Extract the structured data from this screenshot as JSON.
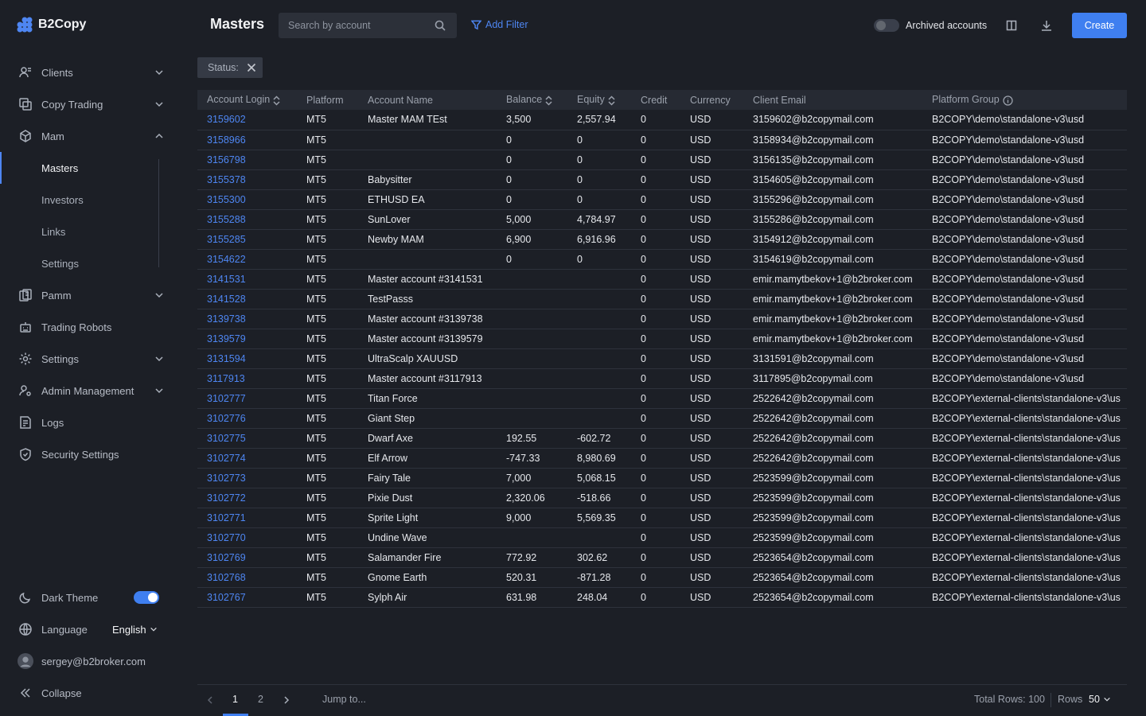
{
  "app": {
    "name": "B2Copy"
  },
  "sidebar": {
    "items": [
      {
        "label": "Clients",
        "icon": "clients-icon",
        "expandable": true
      },
      {
        "label": "Copy Trading",
        "icon": "copy-trading-icon",
        "expandable": true
      },
      {
        "label": "Mam",
        "icon": "mam-icon",
        "expanded": true
      },
      {
        "label": "Pamm",
        "icon": "pamm-icon",
        "expandable": true
      },
      {
        "label": "Trading Robots",
        "icon": "robot-icon"
      },
      {
        "label": "Settings",
        "icon": "gear-icon",
        "expandable": true
      },
      {
        "label": "Admin Management",
        "icon": "admin-icon",
        "expandable": true
      },
      {
        "label": "Logs",
        "icon": "logs-icon"
      },
      {
        "label": "Security Settings",
        "icon": "shield-icon"
      }
    ],
    "mam_sub": [
      "Masters",
      "Investors",
      "Links",
      "Settings"
    ],
    "dark_theme_label": "Dark Theme",
    "dark_theme_on": true,
    "language_label": "Language",
    "language_value": "English",
    "user_email": "sergey@b2broker.com",
    "collapse_label": "Collapse"
  },
  "header": {
    "title": "Masters",
    "search_placeholder": "Search by account",
    "add_filter": "Add Filter",
    "archived_label": "Archived accounts",
    "archived_on": false,
    "create_label": "Create"
  },
  "filter_chip": {
    "label": "Status:"
  },
  "table": {
    "columns": [
      "Account Login",
      "Platform",
      "Account Name",
      "Balance",
      "Equity",
      "Credit",
      "Currency",
      "Client Email",
      "Platform Group"
    ],
    "rows": [
      [
        "3159602",
        "MT5",
        "Master MAM TEst",
        "3,500",
        "2,557.94",
        "0",
        "USD",
        "3159602@b2copymail.com",
        "B2COPY\\demo\\standalone-v3\\usd"
      ],
      [
        "3158966",
        "MT5",
        "",
        "0",
        "0",
        "0",
        "USD",
        "3158934@b2copymail.com",
        "B2COPY\\demo\\standalone-v3\\usd"
      ],
      [
        "3156798",
        "MT5",
        "",
        "0",
        "0",
        "0",
        "USD",
        "3156135@b2copymail.com",
        "B2COPY\\demo\\standalone-v3\\usd"
      ],
      [
        "3155378",
        "MT5",
        "Babysitter",
        "0",
        "0",
        "0",
        "USD",
        "3154605@b2copymail.com",
        "B2COPY\\demo\\standalone-v3\\usd"
      ],
      [
        "3155300",
        "MT5",
        "ETHUSD EA",
        "0",
        "0",
        "0",
        "USD",
        "3155296@b2copymail.com",
        "B2COPY\\demo\\standalone-v3\\usd"
      ],
      [
        "3155288",
        "MT5",
        "SunLover",
        "5,000",
        "4,784.97",
        "0",
        "USD",
        "3155286@b2copymail.com",
        "B2COPY\\demo\\standalone-v3\\usd"
      ],
      [
        "3155285",
        "MT5",
        "Newby MAM",
        "6,900",
        "6,916.96",
        "0",
        "USD",
        "3154912@b2copymail.com",
        "B2COPY\\demo\\standalone-v3\\usd"
      ],
      [
        "3154622",
        "MT5",
        "",
        "0",
        "0",
        "0",
        "USD",
        "3154619@b2copymail.com",
        "B2COPY\\demo\\standalone-v3\\usd"
      ],
      [
        "3141531",
        "MT5",
        "Master account #3141531",
        "",
        "",
        "0",
        "USD",
        "emir.mamytbekov+1@b2broker.com",
        "B2COPY\\demo\\standalone-v3\\usd"
      ],
      [
        "3141528",
        "MT5",
        "TestPasss",
        "",
        "",
        "0",
        "USD",
        "emir.mamytbekov+1@b2broker.com",
        "B2COPY\\demo\\standalone-v3\\usd"
      ],
      [
        "3139738",
        "MT5",
        "Master account #3139738",
        "",
        "",
        "0",
        "USD",
        "emir.mamytbekov+1@b2broker.com",
        "B2COPY\\demo\\standalone-v3\\usd"
      ],
      [
        "3139579",
        "MT5",
        "Master account #3139579",
        "",
        "",
        "0",
        "USD",
        "emir.mamytbekov+1@b2broker.com",
        "B2COPY\\demo\\standalone-v3\\usd"
      ],
      [
        "3131594",
        "MT5",
        "UltraScalp XAUUSD",
        "",
        "",
        "0",
        "USD",
        "3131591@b2copymail.com",
        "B2COPY\\demo\\standalone-v3\\usd"
      ],
      [
        "3117913",
        "MT5",
        "Master account #3117913",
        "",
        "",
        "0",
        "USD",
        "3117895@b2copymail.com",
        "B2COPY\\demo\\standalone-v3\\usd"
      ],
      [
        "3102777",
        "MT5",
        "Titan Force",
        "",
        "",
        "0",
        "USD",
        "2522642@b2copymail.com",
        "B2COPY\\external-clients\\standalone-v3\\us"
      ],
      [
        "3102776",
        "MT5",
        "Giant Step",
        "",
        "",
        "0",
        "USD",
        "2522642@b2copymail.com",
        "B2COPY\\external-clients\\standalone-v3\\us"
      ],
      [
        "3102775",
        "MT5",
        "Dwarf Axe",
        "192.55",
        "-602.72",
        "0",
        "USD",
        "2522642@b2copymail.com",
        "B2COPY\\external-clients\\standalone-v3\\us"
      ],
      [
        "3102774",
        "MT5",
        "Elf Arrow",
        "-747.33",
        "8,980.69",
        "0",
        "USD",
        "2522642@b2copymail.com",
        "B2COPY\\external-clients\\standalone-v3\\us"
      ],
      [
        "3102773",
        "MT5",
        "Fairy Tale",
        "7,000",
        "5,068.15",
        "0",
        "USD",
        "2523599@b2copymail.com",
        "B2COPY\\external-clients\\standalone-v3\\us"
      ],
      [
        "3102772",
        "MT5",
        "Pixie Dust",
        "2,320.06",
        "-518.66",
        "0",
        "USD",
        "2523599@b2copymail.com",
        "B2COPY\\external-clients\\standalone-v3\\us"
      ],
      [
        "3102771",
        "MT5",
        "Sprite Light",
        "9,000",
        "5,569.35",
        "0",
        "USD",
        "2523599@b2copymail.com",
        "B2COPY\\external-clients\\standalone-v3\\us"
      ],
      [
        "3102770",
        "MT5",
        "Undine Wave",
        "",
        "",
        "0",
        "USD",
        "2523599@b2copymail.com",
        "B2COPY\\external-clients\\standalone-v3\\us"
      ],
      [
        "3102769",
        "MT5",
        "Salamander Fire",
        "772.92",
        "302.62",
        "0",
        "USD",
        "2523654@b2copymail.com",
        "B2COPY\\external-clients\\standalone-v3\\us"
      ],
      [
        "3102768",
        "MT5",
        "Gnome Earth",
        "520.31",
        "-871.28",
        "0",
        "USD",
        "2523654@b2copymail.com",
        "B2COPY\\external-clients\\standalone-v3\\us"
      ],
      [
        "3102767",
        "MT5",
        "Sylph Air",
        "631.98",
        "248.04",
        "0",
        "USD",
        "2523654@b2copymail.com",
        "B2COPY\\external-clients\\standalone-v3\\us"
      ]
    ]
  },
  "pagination": {
    "pages": [
      "1",
      "2"
    ],
    "current": "1",
    "jump_placeholder": "Jump to...",
    "total_rows": "Total Rows: 100",
    "rows_label": "Rows",
    "rows_value": "50"
  },
  "colors": {
    "accent": "#3f7ff0",
    "link": "#4e86f2",
    "background": "#1c1f26"
  }
}
